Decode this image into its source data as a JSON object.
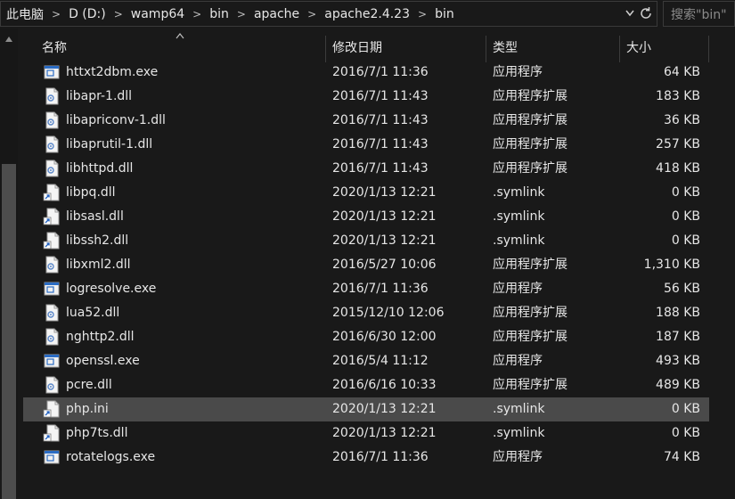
{
  "address": {
    "crumbs": [
      "此电脑",
      "D (D:)",
      "wamp64",
      "bin",
      "apache",
      "apache2.4.23",
      "bin"
    ]
  },
  "search": {
    "placeholder": "搜索\"bin\""
  },
  "columns": {
    "name": "名称",
    "date": "修改日期",
    "type": "类型",
    "size": "大小"
  },
  "files": [
    {
      "name": "httxt2dbm.exe",
      "date": "2016/7/1 11:36",
      "type": "应用程序",
      "size": "64 KB",
      "icon": "exe-icon"
    },
    {
      "name": "libapr-1.dll",
      "date": "2016/7/1 11:43",
      "type": "应用程序扩展",
      "size": "183 KB",
      "icon": "dll-icon"
    },
    {
      "name": "libapriconv-1.dll",
      "date": "2016/7/1 11:43",
      "type": "应用程序扩展",
      "size": "36 KB",
      "icon": "dll-icon"
    },
    {
      "name": "libaprutil-1.dll",
      "date": "2016/7/1 11:43",
      "type": "应用程序扩展",
      "size": "257 KB",
      "icon": "dll-icon"
    },
    {
      "name": "libhttpd.dll",
      "date": "2016/7/1 11:43",
      "type": "应用程序扩展",
      "size": "418 KB",
      "icon": "dll-icon"
    },
    {
      "name": "libpq.dll",
      "date": "2020/1/13 12:21",
      "type": ".symlink",
      "size": "0 KB",
      "icon": "symlink-icon"
    },
    {
      "name": "libsasl.dll",
      "date": "2020/1/13 12:21",
      "type": ".symlink",
      "size": "0 KB",
      "icon": "symlink-icon"
    },
    {
      "name": "libssh2.dll",
      "date": "2020/1/13 12:21",
      "type": ".symlink",
      "size": "0 KB",
      "icon": "symlink-icon"
    },
    {
      "name": "libxml2.dll",
      "date": "2016/5/27 10:06",
      "type": "应用程序扩展",
      "size": "1,310 KB",
      "icon": "dll-icon"
    },
    {
      "name": "logresolve.exe",
      "date": "2016/7/1 11:36",
      "type": "应用程序",
      "size": "56 KB",
      "icon": "exe-icon"
    },
    {
      "name": "lua52.dll",
      "date": "2015/12/10 12:06",
      "type": "应用程序扩展",
      "size": "188 KB",
      "icon": "dll-icon"
    },
    {
      "name": "nghttp2.dll",
      "date": "2016/6/30 12:00",
      "type": "应用程序扩展",
      "size": "187 KB",
      "icon": "dll-icon"
    },
    {
      "name": "openssl.exe",
      "date": "2016/5/4 11:12",
      "type": "应用程序",
      "size": "493 KB",
      "icon": "exe-icon"
    },
    {
      "name": "pcre.dll",
      "date": "2016/6/16 10:33",
      "type": "应用程序扩展",
      "size": "489 KB",
      "icon": "dll-icon"
    },
    {
      "name": "php.ini",
      "date": "2020/1/13 12:21",
      "type": ".symlink",
      "size": "0 KB",
      "icon": "symlink-icon",
      "selected": true
    },
    {
      "name": "php7ts.dll",
      "date": "2020/1/13 12:21",
      "type": ".symlink",
      "size": "0 KB",
      "icon": "symlink-icon"
    },
    {
      "name": "rotatelogs.exe",
      "date": "2016/7/1 11:36",
      "type": "应用程序",
      "size": "74 KB",
      "icon": "exe-icon"
    }
  ]
}
